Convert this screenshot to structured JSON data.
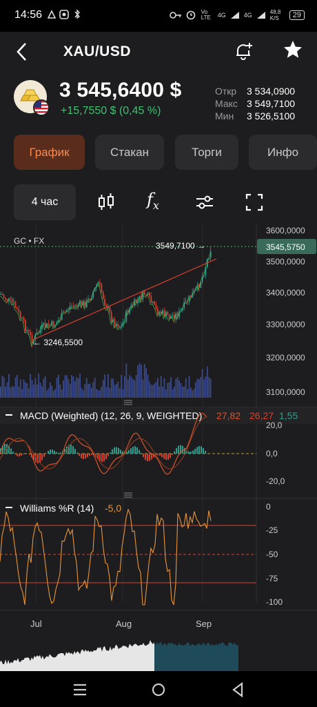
{
  "status_bar": {
    "time": "14:56",
    "left_icons": [
      "app-icon-1",
      "app-icon-2",
      "bluetooth-icon"
    ],
    "net_volte": "Vo LTE",
    "net_4g_1": "4G",
    "net_4g_2": "4G",
    "speed": "48,8 K/S",
    "battery": "29"
  },
  "header": {
    "back_icon": "chevron-left-icon",
    "title": "XAU/USD",
    "bell_icon": "bell-plus-icon",
    "star_icon": "star-icon"
  },
  "quote": {
    "price": "3 545,6400 $",
    "change": "+15,7550 $ (0,45 %)",
    "change_color": "#3bc371",
    "stats": [
      {
        "label": "Откр",
        "value": "3 534,0900"
      },
      {
        "label": "Макс",
        "value": "3 549,7100"
      },
      {
        "label": "Мин",
        "value": "3 526,5100"
      }
    ]
  },
  "tabs": [
    {
      "label": "График",
      "active": true
    },
    {
      "label": "Стакан",
      "active": false
    },
    {
      "label": "Торги",
      "active": false
    },
    {
      "label": "Инфо",
      "active": false
    }
  ],
  "toolbar": {
    "timeframe": "4 час",
    "icons": [
      "candlestick-icon",
      "function-icon",
      "settings-sliders-icon",
      "fullscreen-icon"
    ],
    "fx_label": "f",
    "fx_sub": "x"
  },
  "chart": {
    "symbol_label": "GC • FX",
    "high_marker": "3549,7100 →",
    "low_marker": "← 3246,5500",
    "last_price_badge": "3545,5750",
    "y_ticks": [
      "3600,0000",
      "3500,0000",
      "3400,0000",
      "3300,0000",
      "3200,0000",
      "3100,0000"
    ],
    "macd": {
      "label": "MACD (Weighted) (12, 26, 9, WEIGHTED)",
      "v1": "27,82",
      "v2": "26,27",
      "v3": "1,55",
      "ticks": [
        "20,0",
        "0,0",
        "-20,0"
      ]
    },
    "williams": {
      "label": "Williams %R (14)",
      "value": "-5,0",
      "ticks": [
        "0",
        "-25",
        "-50",
        "-75",
        "-100"
      ]
    },
    "x_ticks": [
      "Jul",
      "Aug",
      "Sep"
    ],
    "colors": {
      "up": "#2e9e8f",
      "down": "#d9412c",
      "macd_line": "#d9542b",
      "signal_line": "#f0a040",
      "williams": "#e8963a",
      "trend": "#d9412c",
      "badge": "#3a6b5a"
    }
  },
  "nav": {
    "icons": [
      "menu-icon",
      "home-circle-icon",
      "back-triangle-icon"
    ]
  }
}
